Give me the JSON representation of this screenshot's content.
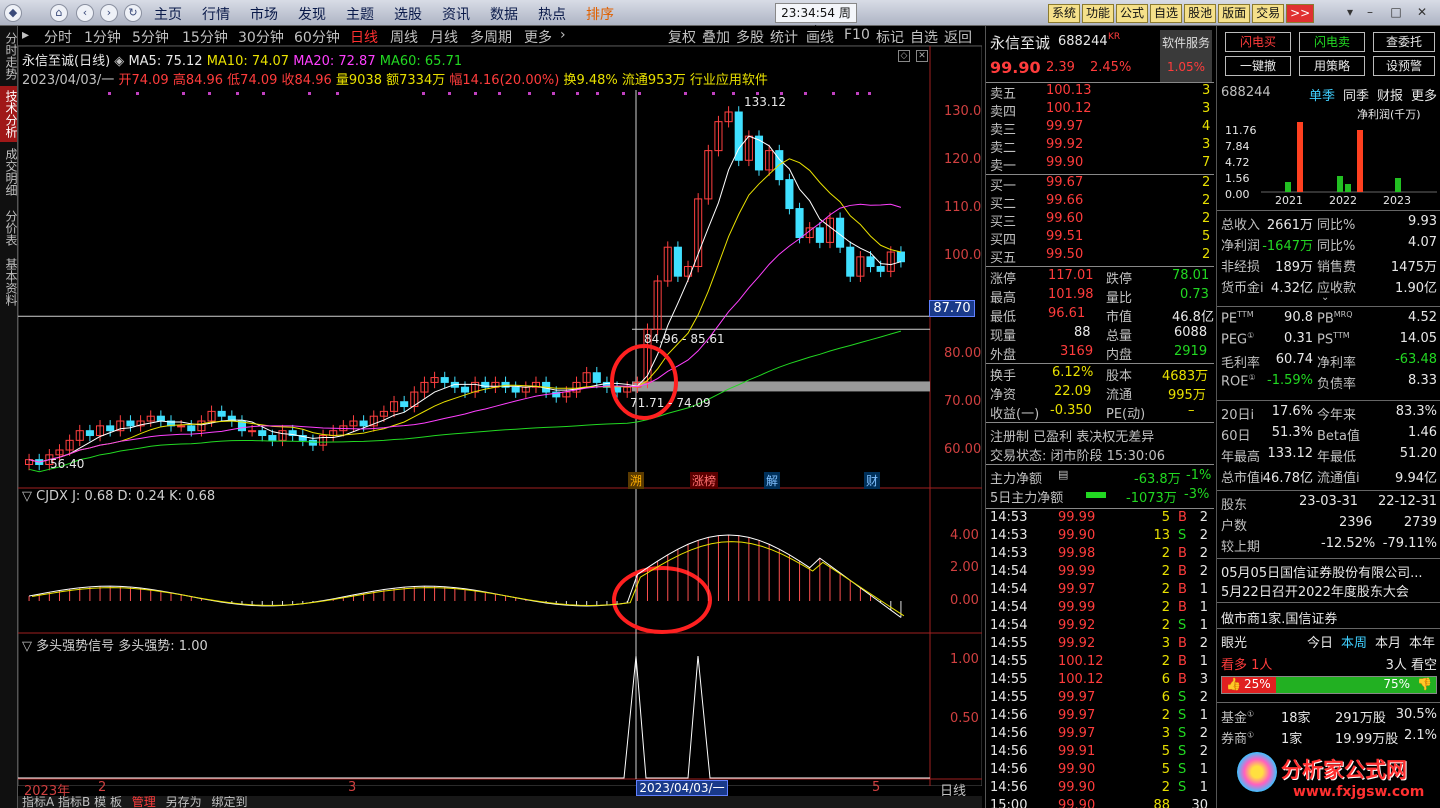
{
  "menu": {
    "items": [
      "主页",
      "行情",
      "市场",
      "发现",
      "主题",
      "选股",
      "资讯",
      "数据",
      "热点",
      "排序"
    ],
    "active": "排序",
    "clock": "23:34:54 周六",
    "right_buttons": [
      "系统",
      "功能",
      "公式",
      "自选",
      "股池",
      "版面",
      "交易",
      ">>"
    ]
  },
  "left_tabs": [
    "分时走势",
    "技术分析",
    "成交明细",
    "分价表",
    "基本资料"
  ],
  "left_tab_active": "技术分析",
  "periods": [
    "分时",
    "1分钟",
    "5分钟",
    "15分钟",
    "30分钟",
    "60分钟",
    "日线",
    "周线",
    "月线",
    "多周期",
    "更多"
  ],
  "period_active": "日线",
  "tools": [
    "复权",
    "叠加",
    "多股",
    "统计",
    "画线",
    "F10",
    "标记",
    "自选",
    "返回"
  ],
  "chart_header": {
    "name": "永信至诚(日线)",
    "ma5": "MA5: 75.12",
    "ma10": "MA10: 74.07",
    "ma20": "MA20: 72.87",
    "ma60": "MA60: 65.71",
    "date": "2023/04/03/一",
    "open": "开74.09",
    "high": "高84.96",
    "low": "低74.09",
    "close": "收84.96",
    "vol": "量9038",
    "amt": "额7334万",
    "chg": "幅14.16(20.00%)",
    "turnover": "换9.48%",
    "float": "流通953万",
    "industry": "行业应用软件"
  },
  "price_axis": [
    "130.0",
    "120.0",
    "110.0",
    "100.0",
    "80.00",
    "70.00",
    "60.00"
  ],
  "price_cursor": "87.70",
  "annotations": {
    "peak": "133.12",
    "low": "56.40",
    "range_hi": "84.96 - 85.61",
    "range_lo": "71.71 - 74.09",
    "markers": [
      "溯",
      "涨榜",
      "解",
      "财"
    ]
  },
  "indicator1": {
    "title": "CJDX J: 0.68  D: 0.24  K: 0.68",
    "axis": [
      "4.00",
      "2.00",
      "0.00"
    ]
  },
  "indicator2": {
    "title": "多头强势信号  多头强势: 1.00",
    "axis": [
      "1.00",
      "0.50"
    ]
  },
  "time_axis": {
    "left": "2023年",
    "m2": "2",
    "m3": "3",
    "cursor": "2023/04/03/一",
    "m5": "5",
    "period": "日线"
  },
  "bottom_tabs": [
    "指标A",
    "指标B",
    "模",
    "板",
    "管理",
    "另存为",
    "绑定到"
  ],
  "quote": {
    "name": "永信至诚",
    "code": "688244",
    "tag": "KR",
    "service": "软件服务",
    "service_pct": "1.05%",
    "price": "99.90",
    "change": "2.39",
    "pct": "2.45%",
    "asks": [
      {
        "label": "卖五",
        "price": "100.13",
        "vol": "3"
      },
      {
        "label": "卖四",
        "price": "100.12",
        "vol": "3"
      },
      {
        "label": "卖三",
        "price": "99.97",
        "vol": "4"
      },
      {
        "label": "卖二",
        "price": "99.92",
        "vol": "3"
      },
      {
        "label": "卖一",
        "price": "99.90",
        "vol": "7"
      }
    ],
    "bids": [
      {
        "label": "买一",
        "price": "99.67",
        "vol": "2"
      },
      {
        "label": "买二",
        "price": "99.66",
        "vol": "2"
      },
      {
        "label": "买三",
        "price": "99.60",
        "vol": "2"
      },
      {
        "label": "买四",
        "price": "99.51",
        "vol": "5"
      },
      {
        "label": "买五",
        "price": "99.50",
        "vol": "2"
      }
    ],
    "stats": [
      {
        "l1": "涨停",
        "v1": "117.01",
        "c1": "red",
        "l2": "跌停",
        "v2": "78.01",
        "c2": "green"
      },
      {
        "l1": "最高",
        "v1": "101.98",
        "c1": "red",
        "l2": "量比",
        "v2": "0.73",
        "c2": "green"
      },
      {
        "l1": "最低",
        "v1": "96.61",
        "c1": "red",
        "l2": "市值",
        "v2": "46.8亿",
        "c2": "white"
      },
      {
        "l1": "现量",
        "v1": "88",
        "c1": "white",
        "l2": "总量",
        "v2": "6088",
        "c2": "white"
      },
      {
        "l1": "外盘",
        "v1": "3169",
        "c1": "red",
        "l2": "内盘",
        "v2": "2919",
        "c2": "green"
      }
    ],
    "stats2": [
      {
        "l1": "换手",
        "v1": "6.12%",
        "l2": "股本",
        "v2": "4683万"
      },
      {
        "l1": "净资",
        "v1": "22.09",
        "l2": "流通",
        "v2": "995万"
      },
      {
        "l1": "收益(一)",
        "v1": "-0.350",
        "l2": "PE(动)",
        "v2": "–"
      }
    ],
    "reg": "注册制 已盈利 表决权无差异",
    "trade_state": "交易状态: 闭市阶段 15:30:06",
    "main_net": {
      "label": "主力净额",
      "val": "-63.8万",
      "pct": "-1%"
    },
    "main_net5": {
      "label": "5日主力净额",
      "val": "-1073万",
      "pct": "-3%"
    },
    "ticks": [
      {
        "t": "14:53",
        "p": "99.99",
        "v": "5",
        "s": "B",
        "n": "2"
      },
      {
        "t": "14:53",
        "p": "99.90",
        "v": "13",
        "s": "S",
        "n": "2"
      },
      {
        "t": "14:53",
        "p": "99.98",
        "v": "2",
        "s": "B",
        "n": "2"
      },
      {
        "t": "14:54",
        "p": "99.99",
        "v": "2",
        "s": "B",
        "n": "2"
      },
      {
        "t": "14:54",
        "p": "99.97",
        "v": "2",
        "s": "B",
        "n": "1"
      },
      {
        "t": "14:54",
        "p": "99.99",
        "v": "2",
        "s": "B",
        "n": "1"
      },
      {
        "t": "14:54",
        "p": "99.92",
        "v": "2",
        "s": "S",
        "n": "1"
      },
      {
        "t": "14:55",
        "p": "99.92",
        "v": "3",
        "s": "B",
        "n": "2"
      },
      {
        "t": "14:55",
        "p": "100.12",
        "v": "2",
        "s": "B",
        "n": "1"
      },
      {
        "t": "14:55",
        "p": "100.12",
        "v": "6",
        "s": "B",
        "n": "3"
      },
      {
        "t": "14:55",
        "p": "99.97",
        "v": "6",
        "s": "S",
        "n": "2"
      },
      {
        "t": "14:56",
        "p": "99.97",
        "v": "2",
        "s": "S",
        "n": "1"
      },
      {
        "t": "14:56",
        "p": "99.97",
        "v": "3",
        "s": "S",
        "n": "2"
      },
      {
        "t": "14:56",
        "p": "99.91",
        "v": "5",
        "s": "S",
        "n": "2"
      },
      {
        "t": "14:56",
        "p": "99.90",
        "v": "5",
        "s": "S",
        "n": "1"
      },
      {
        "t": "14:56",
        "p": "99.90",
        "v": "2",
        "s": "S",
        "n": "1"
      },
      {
        "t": "15:00",
        "p": "99.90",
        "v": "88",
        "s": "",
        "n": "30"
      }
    ]
  },
  "fin": {
    "buttons": [
      "闪电买",
      "闪电卖",
      "查委托",
      "一键撤",
      "用策略",
      "设预警"
    ],
    "code": "688244",
    "tabs": [
      "单季",
      "同季",
      "财报",
      "更多"
    ],
    "tab_active": "单季",
    "chart_title": "净利润(千万)",
    "chart_y": [
      "11.76",
      "7.84",
      "4.72",
      "1.56",
      "0.00"
    ],
    "chart_years": [
      "2021",
      "2022",
      "2023"
    ],
    "rows": [
      {
        "a": "总收入",
        "b": "2661万",
        "c": "同比%",
        "d": "9.93"
      },
      {
        "a": "净利润",
        "b": "-1647万",
        "c": "同比%",
        "d": "4.07"
      },
      {
        "a": "非经损",
        "b": "189万",
        "c": "销售费",
        "d": "1475万"
      },
      {
        "a": "货币金i",
        "b": "4.32亿",
        "c": "应收款",
        "d": "1.90亿"
      }
    ],
    "rows2": [
      {
        "a": "PE",
        "sa": "TTM",
        "b": "90.8",
        "c": "PB",
        "sc": "MRQ",
        "d": "4.52"
      },
      {
        "a": "PEG",
        "sa": "①",
        "b": "0.31",
        "c": "PS",
        "sc": "TTM",
        "d": "14.05"
      },
      {
        "a": "毛利率",
        "sa": "",
        "b": "60.74",
        "c": "净利率",
        "sc": "",
        "d": "-63.48"
      },
      {
        "a": "ROE",
        "sa": "①",
        "b": "-1.59%",
        "c": "负债率",
        "sc": "",
        "d": "8.33"
      }
    ],
    "rows3": [
      {
        "a": "20日i",
        "b": "17.6%",
        "c": "今年来",
        "d": "83.3%"
      },
      {
        "a": "60日",
        "b": "51.3%",
        "c": "Beta值",
        "d": "1.46"
      },
      {
        "a": "年最高",
        "b": "133.12",
        "c": "年最低",
        "d": "51.20"
      },
      {
        "a": "总市值i",
        "b": "46.78亿",
        "c": "流通值i",
        "d": "9.94亿"
      }
    ],
    "holders": {
      "label": "股东",
      "d1": "23-03-31",
      "d2": "22-12-31",
      "r1": {
        "a": "户数",
        "b": "2396",
        "c": "2739"
      },
      "r2": {
        "a": "较上期",
        "b": "-12.52%",
        "c": "-79.11%"
      }
    },
    "news": [
      "05月05日国信证券股份有限公司...",
      "5月22日召开2022年度股东大会"
    ],
    "maker": "做市商1家.国信证券",
    "eye": {
      "label": "眼光",
      "tabs": [
        "今日",
        "本周",
        "本月",
        "本年"
      ],
      "active": "本周"
    },
    "bull": "看多 1人",
    "bear": "3人 看空",
    "bull_pct": "25%",
    "bear_pct": "75%",
    "inst": [
      {
        "a": "基金",
        "sa": "①",
        "b": "18家",
        "c": "291万股",
        "d": "30.5%"
      },
      {
        "a": "券商",
        "sa": "①",
        "b": "1家",
        "c": "19.99万股",
        "d": "2.1%"
      }
    ],
    "watermark": "分析家公式网",
    "watermark_url": "www.fxjgsw.com"
  }
}
